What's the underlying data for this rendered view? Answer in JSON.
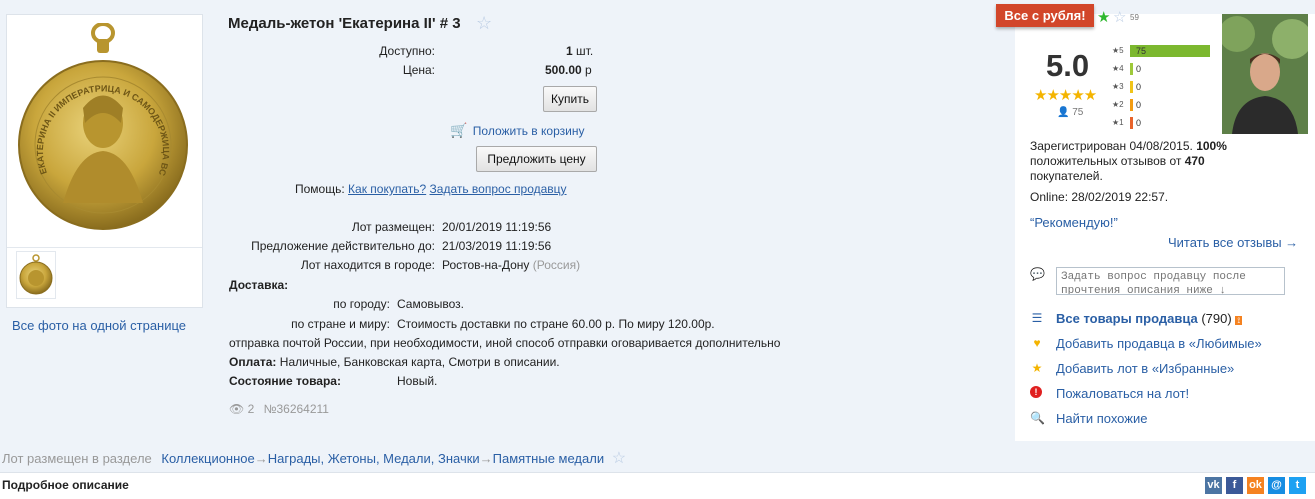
{
  "lot": {
    "title": "Медаль-жетон 'Екатерина II' # 3",
    "available_label": "Доступно:",
    "available_value": "1",
    "available_unit": "шт.",
    "price_label": "Цена:",
    "price_value": "500.00",
    "price_unit": "р",
    "buy_label": "Купить",
    "cart_label": "Положить в корзину",
    "offer_label": "Предложить цену",
    "help_label": "Помощь:",
    "help_how": "Как покупать?",
    "help_ask": "Задать вопрос продавцу",
    "placed_label": "Лот размещен:",
    "placed_value": "20/01/2019 11:19:56",
    "valid_label": "Предложение действительно до:",
    "valid_value": "21/03/2019 11:19:56",
    "city_label": "Лот находится в городе:",
    "city_value": "Ростов-на-Дону",
    "country_value": "(Россия)",
    "delivery_heading": "Доставка:",
    "city_delivery_label": "по городу:",
    "city_delivery_value": "Самовывоз.",
    "world_delivery_label": "по стране и миру:",
    "world_delivery_value": "Стоимость доставки по стране 60.00 р. По миру 120.00р.",
    "delivery_note": "отправка почтой России, при необходимости, иной способ отправки оговаривается дополнительно",
    "payment_label": "Оплата:",
    "payment_value": "Наличные, Банковская карта, Смотри в описании.",
    "condition_label": "Состояние товара:",
    "condition_value": "Новый.",
    "views": "2",
    "lot_number": "№36264211"
  },
  "photos": {
    "all_photos_link": "Все фото на одной странице",
    "medal_text": "ЕКАТЕРИНА II ИМПЕРАТРИЦА И САМОДЕРЖИЦА ВСЕРОССИЙСКАЯ"
  },
  "seller": {
    "badge": "Все с рубля!",
    "feedback_small": "59",
    "rating": "5.0",
    "stars": "★★★★★",
    "reviews": "75",
    "bars": [
      {
        "label": "★5",
        "value": "75",
        "fraction": 1.0
      },
      {
        "label": "★4",
        "value": "0",
        "fraction": 0
      },
      {
        "label": "★3",
        "value": "0",
        "fraction": 0
      },
      {
        "label": "★2",
        "value": "0",
        "fraction": 0
      },
      {
        "label": "★1",
        "value": "0",
        "fraction": 0
      }
    ],
    "reg_text_1": "Зарегистрирован 04/08/2015.",
    "reg_pct": "100%",
    "reg_text_2": "положительных отзывов от",
    "reg_count": "470",
    "reg_text_3": "покупателей.",
    "online": "Online: 28/02/2019 22:57.",
    "recommend": "“Рекомендую!”",
    "read_reviews": "Читать все отзывы →",
    "ask_placeholder": "Задать вопрос продавцу после прочтения описания ниже ↓",
    "all_goods": "Все товары продавца",
    "all_goods_count": "(790)",
    "add_favorite_seller": "Добавить продавца в «Любимые»",
    "add_favorite_lot": "Добавить лот в «Избранные»",
    "complain": "Пожаловаться на лот!",
    "find_similar": "Найти похожие"
  },
  "breadcrumbs": {
    "prefix": "Лот размещен в разделе",
    "items": [
      "Коллекционное",
      "Награды, Жетоны, Медали, Значки",
      "Памятные медали"
    ],
    "sep": "→"
  },
  "description": {
    "title": "Подробное описание"
  },
  "social": {
    "vk": "vk",
    "fb": "f",
    "ok": "ok",
    "mail": "@",
    "tw": "t"
  },
  "colors": {
    "link": "#2a5fa5",
    "badge": "#d2462a",
    "bar5": "#7cb82f",
    "bar4": "#9ec93a",
    "bar3": "#f0c419",
    "bar2": "#f39c12",
    "bar1": "#e8632b"
  }
}
